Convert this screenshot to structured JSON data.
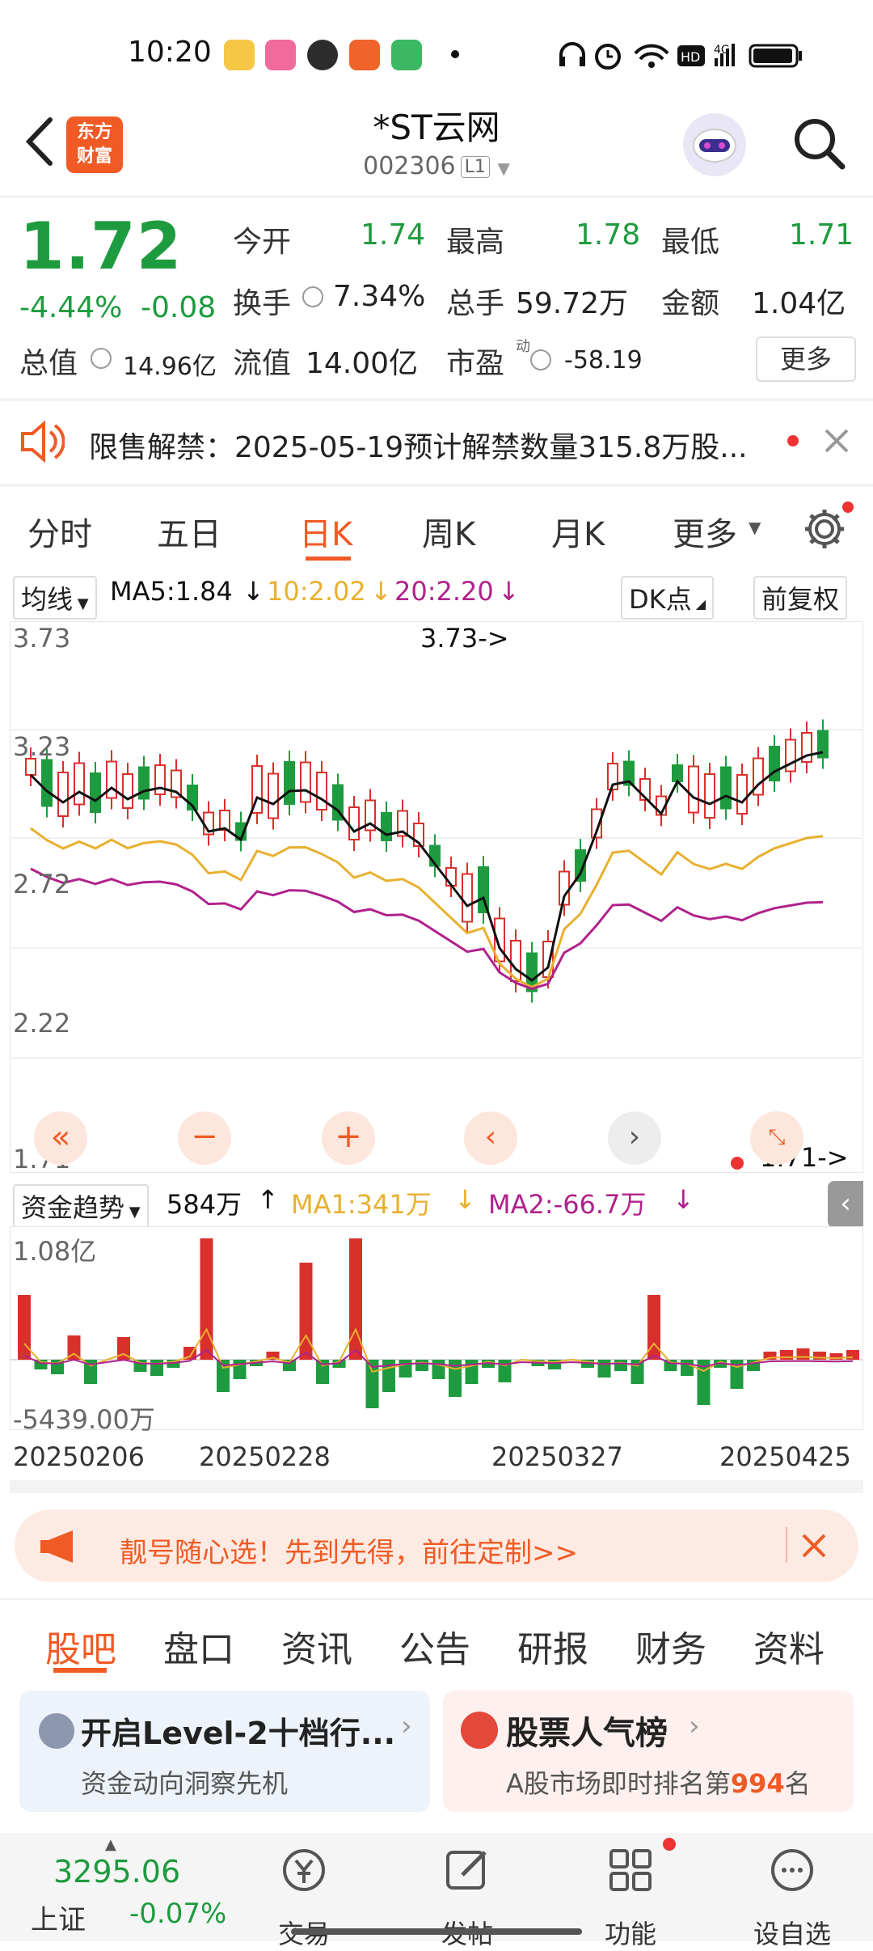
{
  "status_bar": {
    "time": "10:20"
  },
  "header": {
    "logo_line1": "东方",
    "logo_line2": "财富",
    "title": "*ST云网",
    "code": "002306",
    "level": "L1"
  },
  "quote": {
    "price": "1.72",
    "change_pct": "-4.44%",
    "change_abs": "-0.08",
    "open_label": "今开",
    "open": "1.74",
    "high_label": "最高",
    "high": "1.78",
    "low_label": "最低",
    "low": "1.71",
    "turnover_label": "换手",
    "turnover": "7.34%",
    "volume_label": "总手",
    "volume": "59.72万",
    "amount_label": "金额",
    "amount": "1.04亿",
    "total_value_label": "总值",
    "total_value": "14.96亿",
    "float_value_label": "流值",
    "float_value": "14.00亿",
    "pe_label": "市盈",
    "pe_sup": "动",
    "pe": "-58.19",
    "more": "更多"
  },
  "notice": {
    "text": "限售解禁：2025-05-19预计解禁数量315.8万股..."
  },
  "chart_tabs": [
    "分时",
    "五日",
    "日K",
    "周K",
    "月K",
    "更多"
  ],
  "ma_bar": {
    "selector": "均线",
    "ma5": "MA5:1.84",
    "ma10": "10:2.02",
    "ma20": "20:2.20",
    "dk": "DK点",
    "fq": "前复权"
  },
  "kline": {
    "y_labels": [
      "3.73",
      "3.23",
      "2.72",
      "2.22",
      "1.71"
    ],
    "high_marker": "3.73->",
    "last_marker": "1.71->"
  },
  "fund_bar": {
    "selector": "资金趋势",
    "value": "584万",
    "ma1": "MA1:341万",
    "ma2": "MA2:-66.7万"
  },
  "fund_chart": {
    "top_label": "1.08亿",
    "bottom_label": "-5439.00万",
    "dates": [
      "20250206",
      "20250228",
      "20250327",
      "20250425"
    ]
  },
  "ad": {
    "text": "靓号随心选！先到先得，前往定制>>"
  },
  "bottom_tabs": [
    "股吧",
    "盘口",
    "资讯",
    "公告",
    "研报",
    "财务",
    "资料"
  ],
  "cards": {
    "left_title": "开启Level-2十档行...",
    "left_sub": "资金动向洞察先机",
    "right_title": "股票人气榜",
    "right_sub_prefix": "A股市场即时排名第",
    "right_rank": "994",
    "right_sub_suffix": "名"
  },
  "navbar": {
    "index_value": "3295.06",
    "index_name": "上证",
    "index_change": "-0.07%",
    "trade": "交易",
    "post": "发帖",
    "func": "功能",
    "watch": "设自选"
  },
  "colors": {
    "up": "#d9302c",
    "down": "#1e9b3e",
    "accent": "#f05a24",
    "ma5": "#111111",
    "ma10": "#e8b030",
    "ma20": "#b0228c"
  }
}
